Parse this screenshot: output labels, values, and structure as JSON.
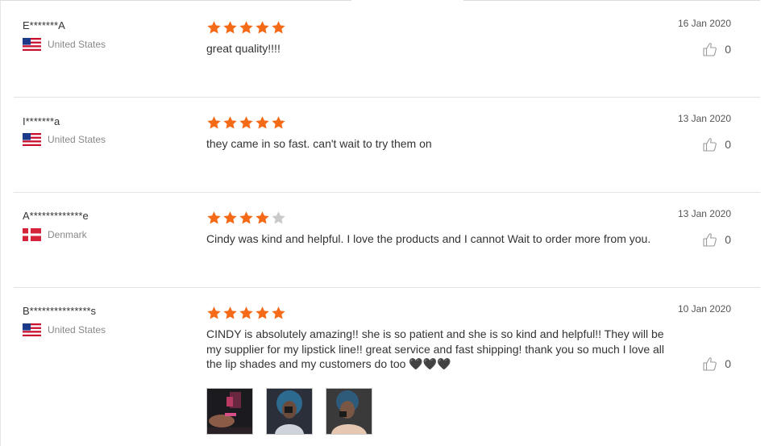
{
  "theme": {
    "star_on": "#f56a17",
    "star_off": "#c9c9c9",
    "divider": "#e3e3e3"
  },
  "reviews": [
    {
      "name": "E*******A",
      "country": "United States",
      "flag": "us-flag-icon",
      "rating": 5,
      "text": "great quality!!!!",
      "date": "16 Jan 2020",
      "helpful": "0",
      "photos": []
    },
    {
      "name": "I*******a",
      "country": "United States",
      "flag": "us-flag-icon",
      "rating": 5,
      "text": "they came in so fast. can't wait to try them on",
      "date": "13 Jan 2020",
      "helpful": "0",
      "photos": []
    },
    {
      "name": "A*************e",
      "country": "Denmark",
      "flag": "dk-flag-icon",
      "rating": 4,
      "text": "Cindy was kind and helpful. I love the products and I cannot Wait to order more from you.",
      "date": "13 Jan 2020",
      "helpful": "0",
      "photos": []
    },
    {
      "name": "B***************s",
      "country": "United States",
      "flag": "us-flag-icon",
      "rating": 5,
      "text": "CINDY is absolutely amazing!! she is so patient and she is so kind and helpful!! They will be my supplier for my lipstick line!! great service and fast shipping! thank you so much I love all the lip shades and my customers do too 🖤🖤🖤",
      "date": "10 Jan 2020",
      "helpful": "0",
      "photos": [
        "review-photo-1",
        "review-photo-2",
        "review-photo-3"
      ]
    }
  ]
}
